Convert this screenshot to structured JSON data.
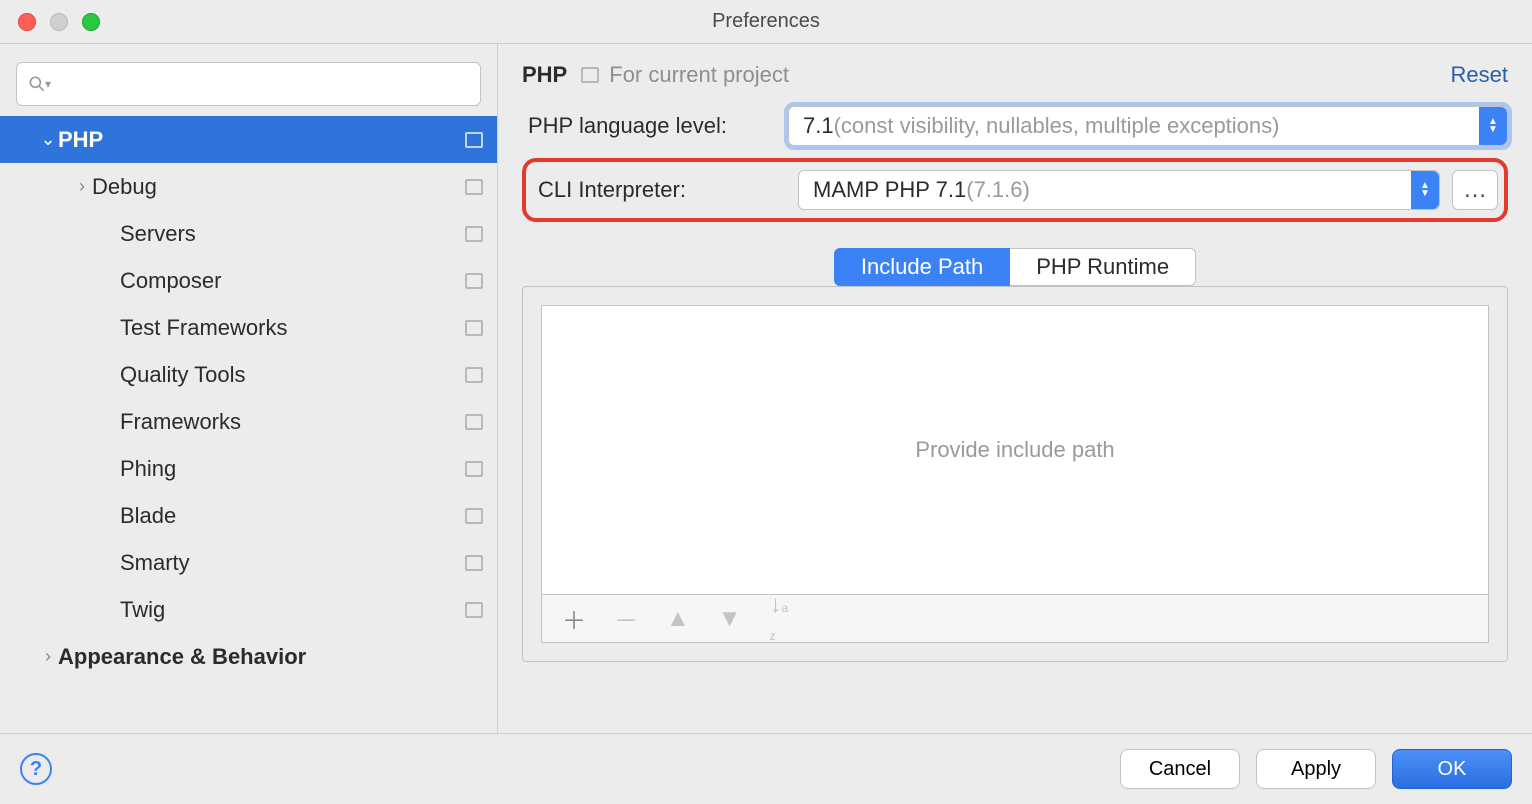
{
  "window": {
    "title": "Preferences"
  },
  "sidebar": {
    "items": [
      {
        "label": "PHP",
        "level": 0,
        "expanded": true,
        "selected": true,
        "bold": true,
        "projIcon": true,
        "hasArrow": true
      },
      {
        "label": "Debug",
        "level": 1,
        "expanded": false,
        "bold": false,
        "projIcon": true,
        "hasArrow": true
      },
      {
        "label": "Servers",
        "level": 2,
        "projIcon": true
      },
      {
        "label": "Composer",
        "level": 2,
        "projIcon": true
      },
      {
        "label": "Test Frameworks",
        "level": 2,
        "projIcon": true
      },
      {
        "label": "Quality Tools",
        "level": 2,
        "projIcon": true
      },
      {
        "label": "Frameworks",
        "level": 2,
        "projIcon": true
      },
      {
        "label": "Phing",
        "level": 2,
        "projIcon": true
      },
      {
        "label": "Blade",
        "level": 2,
        "projIcon": true
      },
      {
        "label": "Smarty",
        "level": 2,
        "projIcon": true
      },
      {
        "label": "Twig",
        "level": 2,
        "projIcon": true
      },
      {
        "label": "Appearance & Behavior",
        "level": 0,
        "expanded": false,
        "bold": true,
        "projIcon": false,
        "hasArrow": true
      }
    ]
  },
  "header": {
    "title": "PHP",
    "subtitle": "For current project",
    "reset": "Reset"
  },
  "form": {
    "langLabel": "PHP language level:",
    "langValue": "7.1",
    "langHint": " (const visibility, nullables, multiple exceptions)",
    "cliLabel": "CLI Interpreter:",
    "cliValue": "MAMP PHP 7.1",
    "cliHint": " (7.1.6)"
  },
  "tabs": {
    "include": "Include Path",
    "runtime": "PHP Runtime"
  },
  "listbox": {
    "placeholder": "Provide include path"
  },
  "footer": {
    "cancel": "Cancel",
    "apply": "Apply",
    "ok": "OK"
  }
}
